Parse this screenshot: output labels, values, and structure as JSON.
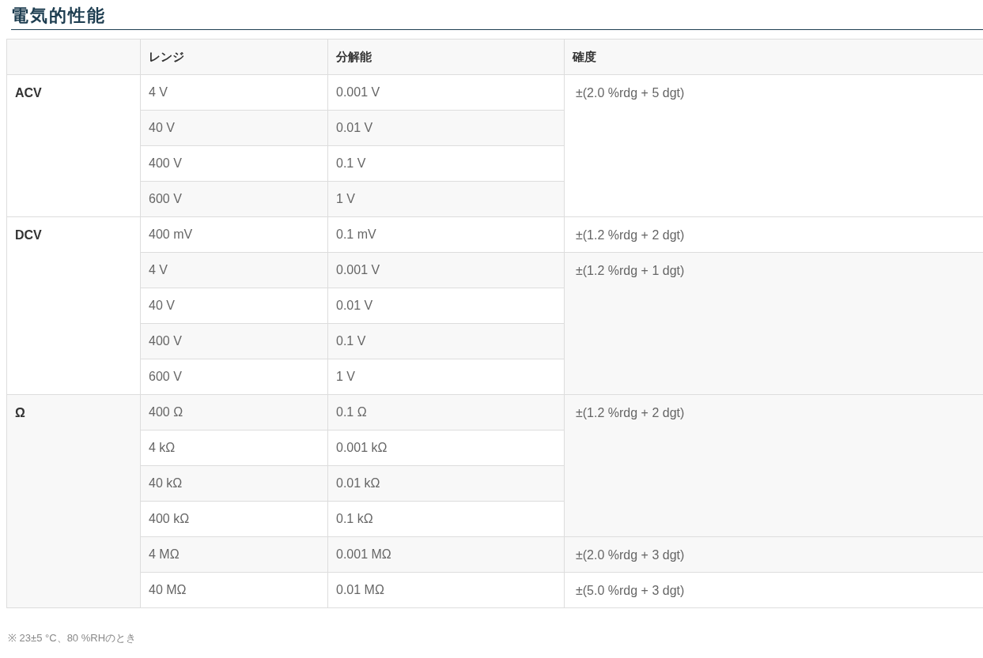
{
  "title": "電気的性能",
  "table": {
    "columns": [
      "",
      "レンジ",
      "分解能",
      "確度"
    ],
    "groups": [
      {
        "label": "ACV",
        "blocks": [
          {
            "accuracy": "±(2.0 %rdg + 5 dgt)",
            "rows": [
              {
                "range": "4 V",
                "resolution": "0.001 V"
              },
              {
                "range": "40 V",
                "resolution": "0.01 V"
              },
              {
                "range": "400 V",
                "resolution": "0.1 V"
              },
              {
                "range": "600 V",
                "resolution": "1 V"
              }
            ]
          }
        ]
      },
      {
        "label": "DCV",
        "blocks": [
          {
            "accuracy": "±(1.2 %rdg + 2 dgt)",
            "rows": [
              {
                "range": "400 mV",
                "resolution": "0.1 mV"
              }
            ]
          },
          {
            "accuracy": "±(1.2 %rdg + 1 dgt)",
            "rows": [
              {
                "range": "4 V",
                "resolution": "0.001 V"
              },
              {
                "range": "40 V",
                "resolution": "0.01 V"
              },
              {
                "range": "400 V",
                "resolution": "0.1 V"
              },
              {
                "range": "600 V",
                "resolution": "1 V"
              }
            ]
          }
        ]
      },
      {
        "label": "Ω",
        "blocks": [
          {
            "accuracy": "±(1.2 %rdg + 2 dgt)",
            "rows": [
              {
                "range": "400 Ω",
                "resolution": "0.1 Ω"
              },
              {
                "range": "4 kΩ",
                "resolution": "0.001 kΩ"
              },
              {
                "range": "40 kΩ",
                "resolution": "0.01 kΩ"
              },
              {
                "range": "400 kΩ",
                "resolution": "0.1 kΩ"
              }
            ]
          },
          {
            "accuracy": "±(2.0 %rdg + 3 dgt)",
            "rows": [
              {
                "range": "4 MΩ",
                "resolution": "0.001 MΩ"
              }
            ]
          },
          {
            "accuracy": "±(5.0 %rdg + 3 dgt)",
            "rows": [
              {
                "range": "40 MΩ",
                "resolution": "0.01 MΩ"
              }
            ]
          }
        ]
      }
    ]
  },
  "footnote": "※ 23±5 °C、80 %RHのとき"
}
